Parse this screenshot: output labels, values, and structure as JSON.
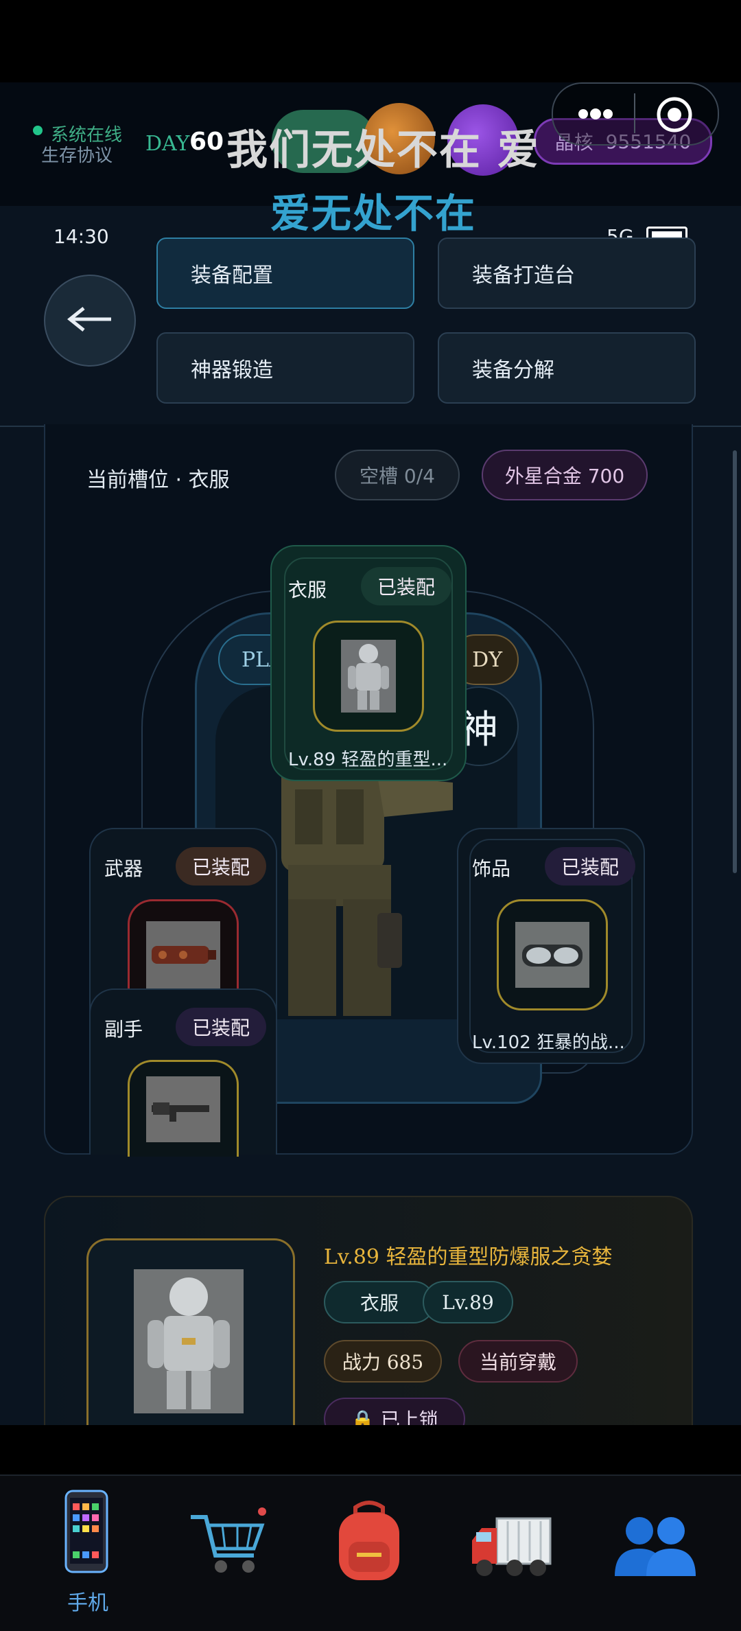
{
  "header": {
    "status_online": "系统在线",
    "status_protocol": "生存协议",
    "day_label": "DAY",
    "day_number": "60",
    "crystal_label": "晶核",
    "crystal_value": "9551540",
    "watermark_line1": "我们无处不在 爱",
    "watermark_line2": "爱无处不在"
  },
  "phone_status": {
    "time": "14:30",
    "network": "5G"
  },
  "nav_tabs": [
    {
      "label": "装备配置",
      "active": true
    },
    {
      "label": "装备打造台",
      "active": false
    },
    {
      "label": "神器锻造",
      "active": false
    },
    {
      "label": "装备分解",
      "active": false
    }
  ],
  "slot_header": {
    "title": "当前槽位 · 衣服",
    "empty_slots": "空槽 0/4",
    "alien_alloy": "外星合金 700"
  },
  "character": {
    "player_tag": "PLA",
    "ready_tag": "DY",
    "god_badge": "神"
  },
  "equipment": {
    "clothes": {
      "slot": "衣服",
      "status": "已装配",
      "name": "Lv.89 轻盈的重型..."
    },
    "weapon": {
      "slot": "武器",
      "status": "已装配"
    },
    "accessory": {
      "slot": "饰品",
      "status": "已装配",
      "name": "Lv.102 狂暴的战..."
    },
    "offhand": {
      "slot": "副手",
      "status": "已装配"
    }
  },
  "detail": {
    "title": "Lv.89 轻盈的重型防爆服之贪婪",
    "tag_slot": "衣服",
    "tag_level": "Lv.89",
    "tag_power": "战力 685",
    "tag_wearing": "当前穿戴",
    "tag_locked": "🔒 已上锁"
  },
  "bottom_nav": {
    "items": [
      {
        "icon": "phone-icon",
        "label": "手机",
        "active": true
      },
      {
        "icon": "cart-icon",
        "label": ""
      },
      {
        "icon": "backpack-icon",
        "label": ""
      },
      {
        "icon": "truck-icon",
        "label": ""
      },
      {
        "icon": "people-icon",
        "label": ""
      }
    ]
  },
  "colors": {
    "accent_blue": "#5fa8e8",
    "gold": "#e8b53c",
    "online_green": "#22c58a"
  }
}
